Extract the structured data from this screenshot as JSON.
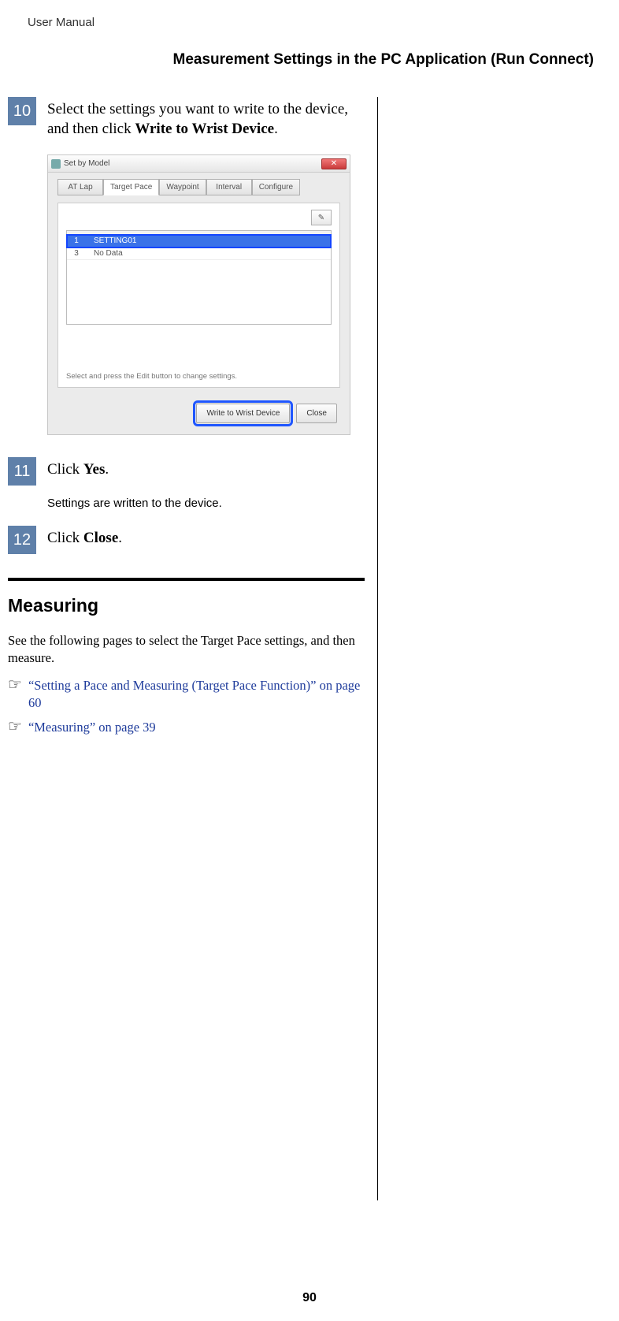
{
  "header_label": "User Manual",
  "section_title": "Measurement Settings in the PC Application (Run Connect)",
  "steps": {
    "s10": {
      "num": "10",
      "text_pre": "Select the settings you want to write to the device, and then click ",
      "text_bold": "Write to Wrist Device",
      "text_post": "."
    },
    "s11": {
      "num": "11",
      "text_pre": "Click ",
      "text_bold": "Yes",
      "text_post": ".",
      "sub": "Settings are written to the device."
    },
    "s12": {
      "num": "12",
      "text_pre": "Click ",
      "text_bold": "Close",
      "text_post": "."
    }
  },
  "screenshot": {
    "window_title": "Set by Model",
    "close_glyph": "✕",
    "tabs": {
      "t1": "AT Lap",
      "t2": "Target Pace",
      "t3": "Waypoint",
      "t4": "Interval",
      "t5": "Configure"
    },
    "edit_glyph": "✎",
    "sel_row": {
      "idx": "1",
      "val": "SETTING01"
    },
    "row3": {
      "idx": "3",
      "val": "No Data"
    },
    "hint": "Select and press the Edit button to change settings.",
    "btn_write": "Write to Wrist Device",
    "btn_close": "Close"
  },
  "measuring": {
    "heading": "Measuring",
    "para": "See the following pages to select the Target Pace settings, and then measure.",
    "xref1": "“Setting a Pace and Measuring (Target Pace Function)” on page 60",
    "xref2": "“Measuring” on page 39",
    "hand_glyph": "☞"
  },
  "page_number": "90"
}
